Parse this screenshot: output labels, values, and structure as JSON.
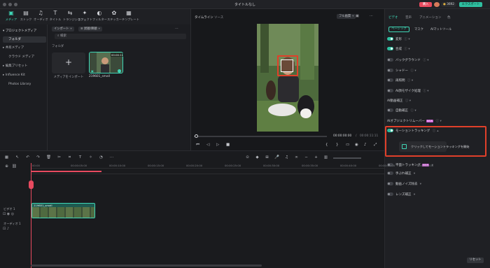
{
  "window": {
    "title": "タイトルなし",
    "buy_label": "購入",
    "credits": "3692",
    "export_label": "エクスポート"
  },
  "toolbar": [
    {
      "icon": "media-icon",
      "label": "メディア"
    },
    {
      "icon": "stock-icon",
      "label": "ストック"
    },
    {
      "icon": "audio-icon",
      "label": "オーディオ"
    },
    {
      "icon": "title-icon",
      "label": "タイトル"
    },
    {
      "icon": "transition-icon",
      "label": "トランジション"
    },
    {
      "icon": "effect-icon",
      "label": "エフェクト"
    },
    {
      "icon": "filter-icon",
      "label": "フィルター"
    },
    {
      "icon": "sticker-icon",
      "label": "ステッカー"
    },
    {
      "icon": "template-icon",
      "label": "テンプレート"
    }
  ],
  "leftnav": {
    "items": [
      "プロジェクトメディア",
      "フォルダ",
      "共有メディア",
      "クラウド メディア",
      "編集プリセット",
      "Influence Kit",
      "Photos Library"
    ]
  },
  "media": {
    "import_label": "インポート",
    "sort_label": "昇順/降順",
    "search_placeholder": "検索",
    "folder_label": "フォルダ",
    "import_card_label": "メディアをインポート",
    "clip_name": "219601_small",
    "clip_duration": "00:00:11"
  },
  "preview": {
    "tabs": [
      "タイムライン",
      "ソース"
    ],
    "quality": "フル画質",
    "time_current": "00:00:00:00",
    "time_total": "00:00:11:11",
    "separator": "/"
  },
  "rpanel": {
    "tabs": [
      "ビデオ",
      "音声",
      "アニメーション",
      "色"
    ],
    "subtabs": [
      "ベーシック",
      "マスク",
      "AIマットツール"
    ],
    "rows": [
      {
        "label": "変形",
        "on": true
      },
      {
        "label": "合成",
        "on": true
      },
      {
        "label": "バックグラウンド",
        "on": false
      },
      {
        "label": "シャドー",
        "on": false
      },
      {
        "label": "再照明",
        "on": false
      },
      {
        "label": "AI顔モザイク処理",
        "on": false
      },
      {
        "label": "AI動画補正",
        "on": null
      },
      {
        "label": "自動補正",
        "on": false
      },
      {
        "label": "AIオブジェクトリムーバー",
        "on": null,
        "badge": "NEW"
      }
    ],
    "motion": {
      "label": "モーショントラッキング",
      "button": "クリックしてモーショントラッキングを開始"
    },
    "rows2": [
      {
        "label": "平面トラッキング",
        "badge": "NEW"
      },
      {
        "label": "手ぶれ補正"
      },
      {
        "label": "動画ノイズ除去"
      },
      {
        "label": "レンズ補正"
      }
    ],
    "reset_label": "リセット"
  },
  "timeline": {
    "ticks": [
      "00:00",
      "00:00:05:00",
      "00:00:10:00",
      "00:00:15:00",
      "00:00:20:00",
      "00:00:25:00",
      "00:00:30:00",
      "00:00:35:00",
      "00:00:40:00",
      "00:00:45:00",
      "00:00:50:00"
    ],
    "video_track": "ビデオ 1",
    "audio_track": "オーディオ 1",
    "clip_name": "219601_small"
  },
  "colors": {
    "accent": "#3fd6b6",
    "highlight": "#e0402a",
    "playhead": "#e84a5f"
  }
}
